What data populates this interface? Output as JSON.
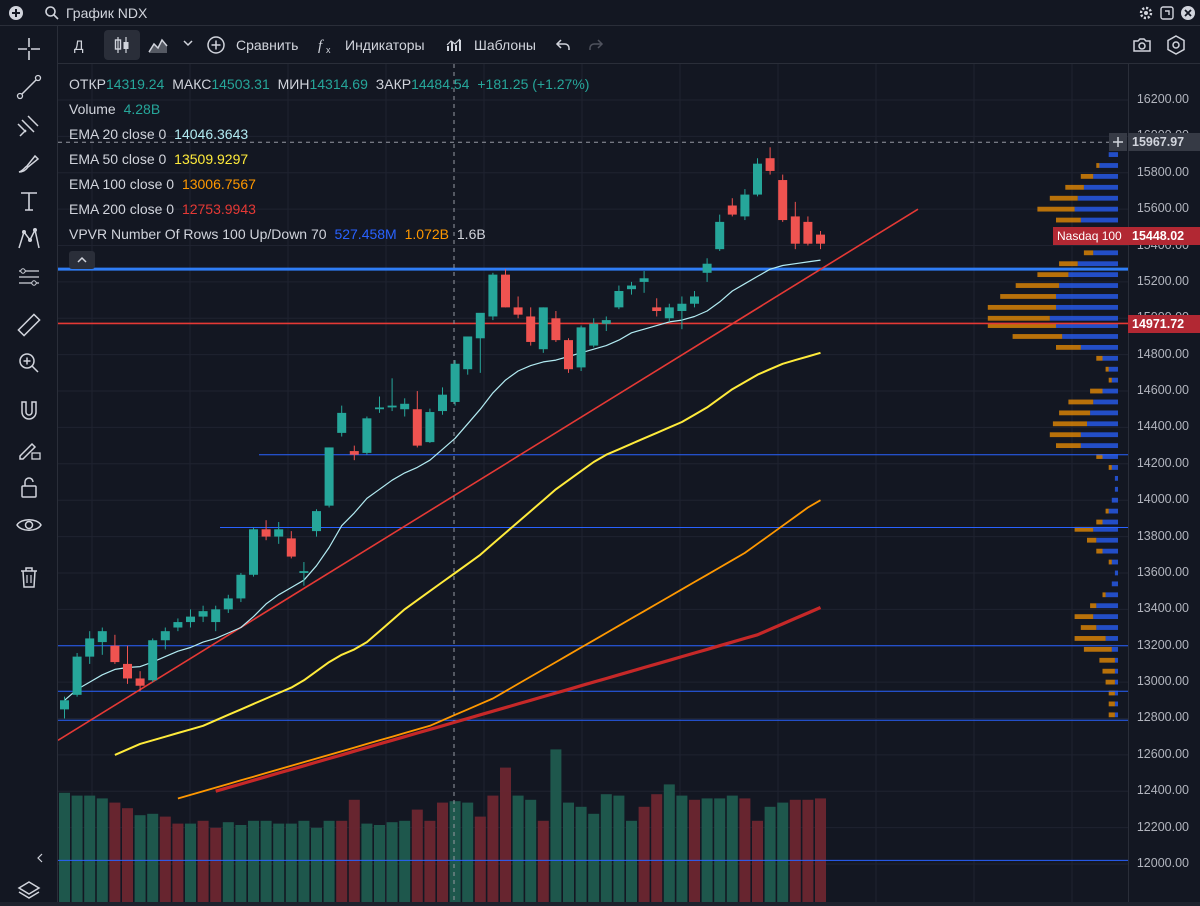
{
  "window": {
    "title": "График NDX"
  },
  "toolbar": {
    "interval": "Д",
    "compare": "Сравнить",
    "indicators": "Индикаторы",
    "templates": "Шаблоны"
  },
  "legend": {
    "ohlc": {
      "open_label": "ОТКР",
      "open": "14319.24",
      "high_label": "МАКС",
      "high": "14503.31",
      "low_label": "МИН",
      "low": "14314.69",
      "close_label": "ЗАКР",
      "close": "14484.54",
      "change": "+181.25 (+1.27%)"
    },
    "volume": {
      "name": "Volume",
      "value": "4.28B"
    },
    "ema20": {
      "name": "EMA 20 close 0",
      "value": "14046.3643",
      "color": "#b2ebf2"
    },
    "ema50": {
      "name": "EMA 50 close 0",
      "value": "13509.9297",
      "color": "#ffeb3b"
    },
    "ema100": {
      "name": "EMA 100 close 0",
      "value": "13006.7567",
      "color": "#ff9800"
    },
    "ema200": {
      "name": "EMA 200 close 0",
      "value": "12753.9943",
      "color": "#e53935"
    },
    "vpvr": {
      "name": "VPVR Number Of Rows 100 Up/Down 70",
      "up": "527.458M",
      "down": "1.072B",
      "total": "1.6B"
    }
  },
  "price_axis": {
    "ticks": [
      "16200.00",
      "16000.00",
      "15800.00",
      "15600.00",
      "15400.00",
      "15200.00",
      "15000.00",
      "14800.00",
      "14600.00",
      "14400.00",
      "14200.00",
      "14000.00",
      "13800.00",
      "13600.00",
      "13400.00",
      "13200.00",
      "13000.00",
      "12800.00",
      "12600.00",
      "12400.00",
      "12200.00",
      "12000.00"
    ],
    "crosshair_price": "15967.97",
    "last_price_label": "Nasdaq 100",
    "last_price": "15448.02",
    "level_price": "14971.72"
  },
  "colors": {
    "up": "#26a69a",
    "down": "#ef5350",
    "vp_up": "#2962ff",
    "vp_down": "#ff9800",
    "hline": "#2962ff",
    "trend": "#e53935"
  },
  "chart_data": {
    "type": "candlestick",
    "symbol": "Nasdaq 100",
    "ylim": [
      11900,
      16320
    ],
    "ohlc": [
      [
        12850,
        12920,
        12800,
        12900
      ],
      [
        12930,
        13160,
        12920,
        13140
      ],
      [
        13140,
        13280,
        13100,
        13240
      ],
      [
        13220,
        13300,
        13150,
        13280
      ],
      [
        13200,
        13260,
        13100,
        13110
      ],
      [
        13100,
        13200,
        12990,
        13020
      ],
      [
        13020,
        13060,
        12950,
        12980
      ],
      [
        13010,
        13240,
        13000,
        13230
      ],
      [
        13230,
        13300,
        13180,
        13280
      ],
      [
        13300,
        13350,
        13280,
        13330
      ],
      [
        13330,
        13400,
        13300,
        13360
      ],
      [
        13360,
        13420,
        13330,
        13390
      ],
      [
        13330,
        13420,
        13280,
        13400
      ],
      [
        13400,
        13480,
        13380,
        13460
      ],
      [
        13460,
        13600,
        13440,
        13590
      ],
      [
        13590,
        13850,
        13580,
        13840
      ],
      [
        13840,
        13890,
        13780,
        13800
      ],
      [
        13800,
        13880,
        13760,
        13840
      ],
      [
        13790,
        13830,
        13680,
        13690
      ],
      [
        13600,
        13660,
        13530,
        13610
      ],
      [
        13830,
        13950,
        13800,
        13940
      ],
      [
        13970,
        14290,
        13960,
        14290
      ],
      [
        14370,
        14520,
        14350,
        14480
      ],
      [
        14270,
        14300,
        14220,
        14250
      ],
      [
        14260,
        14460,
        14250,
        14450
      ],
      [
        14500,
        14570,
        14480,
        14510
      ],
      [
        14510,
        14670,
        14490,
        14520
      ],
      [
        14500,
        14560,
        14460,
        14530
      ],
      [
        14500,
        14600,
        14290,
        14300
      ],
      [
        14319.24,
        14503.31,
        14314.69,
        14484.54
      ],
      [
        14490,
        14620,
        14470,
        14580
      ],
      [
        14540,
        14770,
        14520,
        14750
      ],
      [
        14720,
        14850,
        14690,
        14900
      ],
      [
        14890,
        15000,
        14700,
        15030
      ],
      [
        15010,
        15250,
        14990,
        15240
      ],
      [
        15240,
        15270,
        15060,
        15060
      ],
      [
        15060,
        15120,
        15000,
        15020
      ],
      [
        15010,
        15060,
        14850,
        14870
      ],
      [
        14830,
        15060,
        14810,
        15060
      ],
      [
        15000,
        15040,
        14870,
        14880
      ],
      [
        14880,
        14890,
        14700,
        14720
      ],
      [
        14730,
        14960,
        14710,
        14950
      ],
      [
        14850,
        15000,
        14840,
        14970
      ],
      [
        14970,
        15010,
        14930,
        14990
      ],
      [
        15060,
        15180,
        15050,
        15150
      ],
      [
        15160,
        15200,
        15130,
        15180
      ],
      [
        15200,
        15260,
        15140,
        15220
      ],
      [
        15060,
        15110,
        15010,
        15040
      ],
      [
        15000,
        15080,
        14980,
        15060
      ],
      [
        15040,
        15120,
        14940,
        15080
      ],
      [
        15080,
        15150,
        15060,
        15120
      ],
      [
        15250,
        15330,
        15200,
        15300
      ],
      [
        15380,
        15570,
        15370,
        15530
      ],
      [
        15620,
        15660,
        15560,
        15570
      ],
      [
        15560,
        15710,
        15540,
        15680
      ],
      [
        15680,
        15880,
        15670,
        15850
      ],
      [
        15880,
        15940,
        15790,
        15810
      ],
      [
        15760,
        15790,
        15530,
        15540
      ],
      [
        15560,
        15640,
        15380,
        15410
      ],
      [
        15530,
        15560,
        15400,
        15410
      ],
      [
        15460,
        15480,
        15380,
        15410
      ]
    ],
    "volume": [
      [
        1,
        0.78
      ],
      [
        1,
        0.76
      ],
      [
        1,
        0.76
      ],
      [
        1,
        0.74
      ],
      [
        0,
        0.71
      ],
      [
        0,
        0.67
      ],
      [
        1,
        0.62
      ],
      [
        1,
        0.63
      ],
      [
        0,
        0.61
      ],
      [
        0,
        0.56
      ],
      [
        1,
        0.56
      ],
      [
        0,
        0.58
      ],
      [
        0,
        0.53
      ],
      [
        1,
        0.57
      ],
      [
        1,
        0.55
      ],
      [
        1,
        0.58
      ],
      [
        1,
        0.58
      ],
      [
        1,
        0.56
      ],
      [
        1,
        0.56
      ],
      [
        1,
        0.58
      ],
      [
        1,
        0.53
      ],
      [
        1,
        0.58
      ],
      [
        0,
        0.58
      ],
      [
        0,
        0.73
      ],
      [
        1,
        0.56
      ],
      [
        1,
        0.55
      ],
      [
        1,
        0.57
      ],
      [
        1,
        0.58
      ],
      [
        0,
        0.66
      ],
      [
        0,
        0.58
      ],
      [
        0,
        0.71
      ],
      [
        1,
        0.72
      ],
      [
        1,
        0.71
      ],
      [
        0,
        0.61
      ],
      [
        0,
        0.76
      ],
      [
        0,
        0.96
      ],
      [
        1,
        0.76
      ],
      [
        1,
        0.73
      ],
      [
        0,
        0.58
      ],
      [
        1,
        1.09
      ],
      [
        1,
        0.71
      ],
      [
        1,
        0.68
      ],
      [
        1,
        0.63
      ],
      [
        1,
        0.77
      ],
      [
        1,
        0.76
      ],
      [
        1,
        0.58
      ],
      [
        0,
        0.68
      ],
      [
        0,
        0.77
      ],
      [
        1,
        0.84
      ],
      [
        1,
        0.76
      ],
      [
        0,
        0.73
      ],
      [
        1,
        0.74
      ],
      [
        1,
        0.74
      ],
      [
        1,
        0.76
      ],
      [
        0,
        0.74
      ],
      [
        0,
        0.58
      ],
      [
        1,
        0.68
      ],
      [
        1,
        0.71
      ],
      [
        0,
        0.73
      ],
      [
        0,
        0.73
      ],
      [
        0,
        0.74
      ]
    ],
    "ema20": [
      12900,
      12960,
      13000,
      13040,
      13070,
      13080,
      13085,
      13110,
      13140,
      13170,
      13190,
      13220,
      13240,
      13270,
      13300,
      13360,
      13430,
      13480,
      13520,
      13560,
      13640,
      13740,
      13860,
      13930,
      14010,
      14060,
      14110,
      14150,
      14180,
      14220,
      14280,
      14340,
      14420,
      14500,
      14590,
      14660,
      14710,
      14740,
      14760,
      14770,
      14790,
      14810,
      14830,
      14850,
      14880,
      14920,
      14940,
      14960,
      14980,
      14990,
      15010,
      15040,
      15090,
      15150,
      15190,
      15230,
      15270,
      15290,
      15300,
      15310,
      15320
    ],
    "ema50": [
      12600,
      12630,
      12660,
      12680,
      12700,
      12720,
      12740,
      12760,
      12790,
      12820,
      12850,
      12880,
      12910,
      12940,
      12970,
      13010,
      13060,
      13110,
      13150,
      13180,
      13220,
      13280,
      13340,
      13400,
      13450,
      13500,
      13550,
      13600,
      13650,
      13700,
      13760,
      13820,
      13880,
      13940,
      14000,
      14060,
      14110,
      14160,
      14210,
      14250,
      14280,
      14310,
      14340,
      14370,
      14400,
      14430,
      14470,
      14510,
      14560,
      14610,
      14650,
      14690,
      14720,
      14750,
      14770,
      14790,
      14810
    ],
    "ema100": [
      12360,
      12380,
      12400,
      12420,
      12440,
      12460,
      12480,
      12500,
      12520,
      12540,
      12560,
      12580,
      12600,
      12620,
      12640,
      12660,
      12680,
      12700,
      12720,
      12740,
      12760,
      12790,
      12820,
      12850,
      12880,
      12910,
      12950,
      12990,
      13030,
      13070,
      13110,
      13150,
      13190,
      13230,
      13270,
      13310,
      13350,
      13390,
      13430,
      13470,
      13510,
      13550,
      13590,
      13630,
      13670,
      13710,
      13760,
      13810,
      13860,
      13910,
      13960,
      14000
    ],
    "ema200": [
      12400,
      12420,
      12440,
      12460,
      12480,
      12500,
      12520,
      12540,
      12560,
      12580,
      12600,
      12620,
      12640,
      12660,
      12680,
      12700,
      12720,
      12740,
      12760,
      12780,
      12800,
      12820,
      12840,
      12860,
      12880,
      12900,
      12920,
      12940,
      12960,
      12980,
      13000,
      13020,
      13040,
      13060,
      13080,
      13100,
      13120,
      13140,
      13160,
      13180,
      13200,
      13220,
      13240,
      13260,
      13290,
      13320,
      13350,
      13380,
      13410
    ],
    "horizontal_levels": [
      15967.97,
      15270,
      14971.72,
      14250,
      13850,
      13200,
      12950,
      12790,
      12020
    ],
    "vpvr": [
      [
        15900,
        0.03,
        0.0
      ],
      [
        15840,
        0.06,
        0.01
      ],
      [
        15780,
        0.08,
        0.04
      ],
      [
        15720,
        0.11,
        0.06
      ],
      [
        15660,
        0.13,
        0.09
      ],
      [
        15600,
        0.14,
        0.12
      ],
      [
        15540,
        0.12,
        0.08
      ],
      [
        15480,
        0.06,
        0.02
      ],
      [
        15420,
        0.05,
        0.02
      ],
      [
        15360,
        0.08,
        0.03
      ],
      [
        15300,
        0.13,
        0.06
      ],
      [
        15240,
        0.16,
        0.1
      ],
      [
        15180,
        0.19,
        0.14
      ],
      [
        15120,
        0.2,
        0.18
      ],
      [
        15060,
        0.2,
        0.22
      ],
      [
        15000,
        0.22,
        0.2
      ],
      [
        14960,
        0.2,
        0.22
      ],
      [
        14900,
        0.18,
        0.16
      ],
      [
        14840,
        0.12,
        0.08
      ],
      [
        14780,
        0.05,
        0.02
      ],
      [
        14720,
        0.03,
        0.01
      ],
      [
        14660,
        0.02,
        0.01
      ],
      [
        14600,
        0.05,
        0.04
      ],
      [
        14540,
        0.08,
        0.08
      ],
      [
        14480,
        0.09,
        0.1
      ],
      [
        14420,
        0.1,
        0.11
      ],
      [
        14360,
        0.12,
        0.1
      ],
      [
        14300,
        0.12,
        0.08
      ],
      [
        14240,
        0.05,
        0.02
      ],
      [
        14180,
        0.02,
        0.01
      ],
      [
        14120,
        0.01,
        0.0
      ],
      [
        14060,
        0.01,
        0.0
      ],
      [
        14000,
        0.02,
        0.0
      ],
      [
        13940,
        0.03,
        0.01
      ],
      [
        13880,
        0.05,
        0.02
      ],
      [
        13840,
        0.08,
        0.06
      ],
      [
        13780,
        0.07,
        0.03
      ],
      [
        13720,
        0.05,
        0.02
      ],
      [
        13660,
        0.02,
        0.01
      ],
      [
        13600,
        0.01,
        0.0
      ],
      [
        13540,
        0.02,
        0.0
      ],
      [
        13480,
        0.04,
        0.01
      ],
      [
        13420,
        0.07,
        0.02
      ],
      [
        13360,
        0.08,
        0.06
      ],
      [
        13300,
        0.07,
        0.05
      ],
      [
        13240,
        0.04,
        0.1
      ],
      [
        13180,
        0.02,
        0.09
      ],
      [
        13120,
        0.01,
        0.05
      ],
      [
        13060,
        0.01,
        0.04
      ],
      [
        13000,
        0.01,
        0.03
      ],
      [
        12940,
        0.01,
        0.02
      ],
      [
        12880,
        0.01,
        0.02
      ],
      [
        12820,
        0.01,
        0.02
      ]
    ]
  }
}
